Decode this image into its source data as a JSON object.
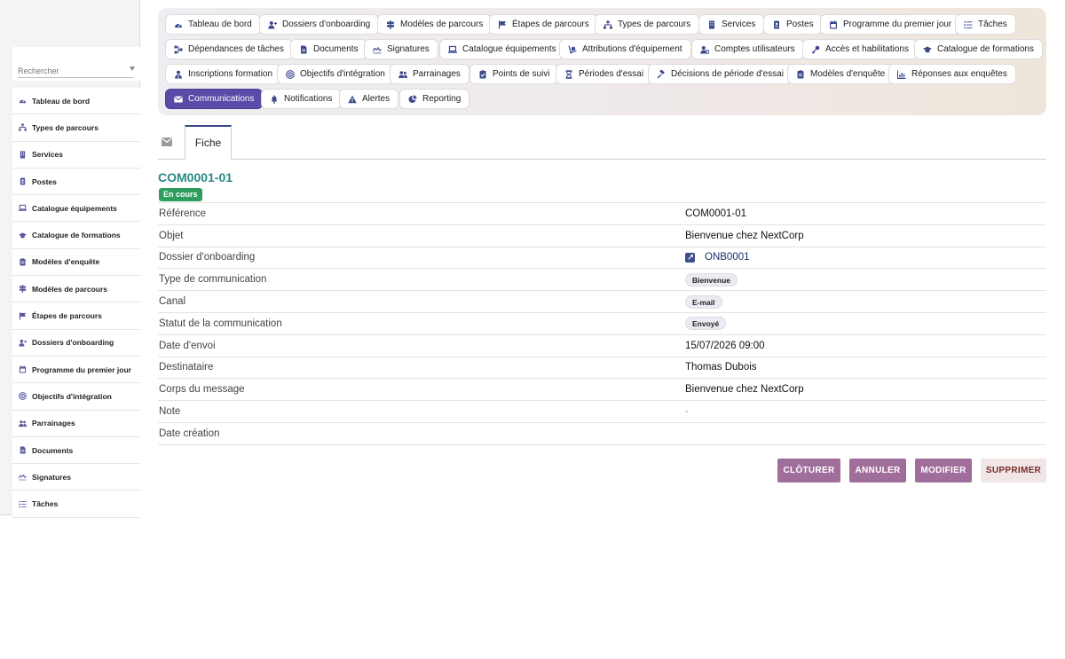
{
  "sidebar": {
    "search_placeholder": "Rechercher",
    "items": [
      {
        "label": "Tableau de bord",
        "icon": "dashboard-icon"
      },
      {
        "label": "Types de parcours",
        "icon": "sitemap-icon"
      },
      {
        "label": "Services",
        "icon": "building-icon"
      },
      {
        "label": "Postes",
        "icon": "id-badge-icon"
      },
      {
        "label": "Catalogue équipements",
        "icon": "laptop-icon"
      },
      {
        "label": "Catalogue de formations",
        "icon": "graduation-cap-icon"
      },
      {
        "label": "Modèles d'enquête",
        "icon": "clipboard-icon"
      },
      {
        "label": "Modèles de parcours",
        "icon": "signpost-icon"
      },
      {
        "label": "Étapes de parcours",
        "icon": "flag-icon"
      },
      {
        "label": "Dossiers d'onboarding",
        "icon": "user-plus-icon"
      },
      {
        "label": "Programme du premier jour",
        "icon": "calendar-icon"
      },
      {
        "label": "Objectifs d'intégration",
        "icon": "target-icon"
      },
      {
        "label": "Parrainages",
        "icon": "users-icon"
      },
      {
        "label": "Documents",
        "icon": "file-icon"
      },
      {
        "label": "Signatures",
        "icon": "signature-icon"
      },
      {
        "label": "Tâches",
        "icon": "list-icon"
      }
    ]
  },
  "topnav": {
    "items": [
      {
        "label": "Tableau de bord",
        "icon": "dashboard-icon"
      },
      {
        "label": "Dossiers d'onboarding",
        "icon": "user-plus-icon"
      },
      {
        "label": "Modèles de parcours",
        "icon": "signpost-icon"
      },
      {
        "label": "Étapes de parcours",
        "icon": "flag-icon"
      },
      {
        "label": "Types de parcours",
        "icon": "sitemap-icon"
      },
      {
        "label": "Services",
        "icon": "building-icon"
      },
      {
        "label": "Postes",
        "icon": "id-badge-icon"
      },
      {
        "label": "Programme du premier jour",
        "icon": "calendar-icon"
      },
      {
        "label": "Tâches",
        "icon": "list-icon"
      },
      {
        "label": "Dépendances de tâches",
        "icon": "diagram-icon"
      },
      {
        "label": "Documents",
        "icon": "file-icon"
      },
      {
        "label": "Signatures",
        "icon": "signature-icon"
      },
      {
        "label": "Catalogue équipements",
        "icon": "laptop-icon"
      },
      {
        "label": "Attributions d'équipement",
        "icon": "dolly-icon"
      },
      {
        "label": "Comptes utilisateurs",
        "icon": "user-gear-icon"
      },
      {
        "label": "Accès et habilitations",
        "icon": "key-icon"
      },
      {
        "label": "Catalogue de formations",
        "icon": "graduation-cap-icon"
      },
      {
        "label": "Inscriptions formation",
        "icon": "user-tie-icon"
      },
      {
        "label": "Objectifs d'intégration",
        "icon": "target-icon"
      },
      {
        "label": "Parrainages",
        "icon": "users-icon"
      },
      {
        "label": "Points de suivi",
        "icon": "clipboard-check-icon"
      },
      {
        "label": "Périodes d'essai",
        "icon": "hourglass-icon"
      },
      {
        "label": "Décisions de période d'essai",
        "icon": "gavel-icon"
      },
      {
        "label": "Modèles d'enquête",
        "icon": "clipboard-icon"
      },
      {
        "label": "Réponses aux enquêtes",
        "icon": "chart-icon"
      },
      {
        "label": "Communications",
        "icon": "envelope-icon",
        "active": true
      },
      {
        "label": "Notifications",
        "icon": "bell-icon"
      },
      {
        "label": "Alertes",
        "icon": "warning-icon"
      },
      {
        "label": "Reporting",
        "icon": "pie-chart-icon"
      }
    ]
  },
  "tabs": {
    "fiche": "Fiche"
  },
  "record": {
    "title": "COM0001-01",
    "status": "En cours",
    "status_color": "#2e9e5e",
    "fields": [
      {
        "label": "Référence",
        "value": "COM0001-01",
        "kind": "text"
      },
      {
        "label": "Objet",
        "value": "Bienvenue chez NextCorp",
        "kind": "text"
      },
      {
        "label": "Dossier d'onboarding",
        "value": "ONB0001",
        "kind": "link"
      },
      {
        "label": "Type de communication",
        "value": "Bienvenue",
        "kind": "chip"
      },
      {
        "label": "Canal",
        "value": "E-mail",
        "kind": "chip"
      },
      {
        "label": "Statut de la communication",
        "value": "Envoyé",
        "kind": "chip"
      },
      {
        "label": "Date d'envoi",
        "value": "15/07/2026 09:00",
        "kind": "text"
      },
      {
        "label": "Destinataire",
        "value": "Thomas Dubois",
        "kind": "text"
      },
      {
        "label": "Corps du message",
        "value": "Bienvenue chez NextCorp",
        "kind": "text"
      },
      {
        "label": "Note",
        "value": "-",
        "kind": "muted"
      },
      {
        "label": "Date création",
        "value": "",
        "kind": "text"
      }
    ]
  },
  "actions": {
    "cloturer": "CLÔTURER",
    "annuler": "ANNULER",
    "modifier": "MODIFIER",
    "supprimer": "SUPPRIMER"
  },
  "colors": {
    "accent": "#5b4aa8",
    "action": "#a06e9a",
    "title": "#2a8a86"
  }
}
